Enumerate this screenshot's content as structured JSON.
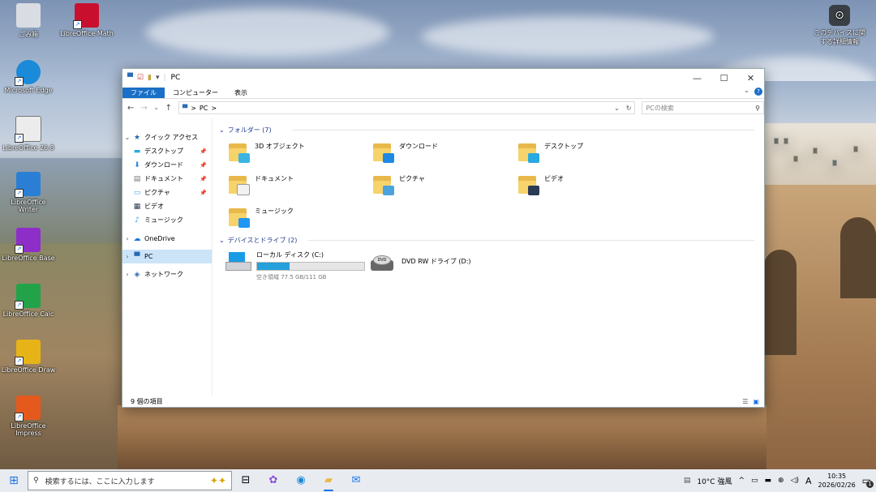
{
  "desktop": {
    "icons": [
      {
        "label": "ごみ箱",
        "icon": "recycle-bin-icon",
        "color": "#d9dde3"
      },
      {
        "label": "LibreOffice Math",
        "icon": "libreoffice-math-icon",
        "color": "#c8102e"
      },
      {
        "label": "Microsoft Edge",
        "icon": "edge-icon",
        "color": "#1b8ad8"
      },
      {
        "label": "LibreOffice 26.8",
        "icon": "libreoffice-icon",
        "color": "#ececec"
      },
      {
        "label": "LibreOffice Writer",
        "icon": "libreoffice-writer-icon",
        "color": "#2a7fd4"
      },
      {
        "label": "LibreOffice Base",
        "icon": "libreoffice-base-icon",
        "color": "#8e2ec9"
      },
      {
        "label": "LibreOffice Calc",
        "icon": "libreoffice-calc-icon",
        "color": "#22a34a"
      },
      {
        "label": "LibreOffice Draw",
        "icon": "libreoffice-draw-icon",
        "color": "#e7b417"
      },
      {
        "label": "LibreOffice Impress",
        "icon": "libreoffice-impress-icon",
        "color": "#e55a1c"
      },
      {
        "label": "このデバイスに関する詳細情報",
        "icon": "device-info-icon",
        "color": "#3a3f45"
      }
    ]
  },
  "explorer": {
    "title": "PC",
    "window_controls": {
      "minimize": "—",
      "maximize": "☐",
      "close": "✕"
    },
    "ribbon_tabs": [
      "ファイル",
      "コンピューター",
      "表示"
    ],
    "address": {
      "path_root": "PC",
      "separator": ">"
    },
    "search_placeholder": "PCの検索",
    "nav": {
      "quick_access": "クイック アクセス",
      "quick_items": [
        "デスクトップ",
        "ダウンロード",
        "ドキュメント",
        "ピクチャ",
        "ビデオ",
        "ミュージック"
      ],
      "onedrive": "OneDrive",
      "pc": "PC",
      "network": "ネットワーク"
    },
    "folders_group": "フォルダー (7)",
    "folders": [
      {
        "name": "3D オブジェクト",
        "badge": "#3bb4e5"
      },
      {
        "name": "ダウンロード",
        "badge": "#1e88e5"
      },
      {
        "name": "デスクトップ",
        "badge": "#29a9e1"
      },
      {
        "name": "ドキュメント",
        "badge": "#f2f2f2"
      },
      {
        "name": "ピクチャ",
        "badge": "#4aa3df"
      },
      {
        "name": "ビデオ",
        "badge": "#2b3a55"
      },
      {
        "name": "ミュージック",
        "badge": "#2196f3"
      }
    ],
    "drives_group": "デバイスとドライブ (2)",
    "drives": [
      {
        "name": "ローカル ディスク (C:)",
        "free_text": "空き領域 77.5 GB/111 GB",
        "used_fraction": 0.3
      },
      {
        "name": "DVD RW ドライブ (D:)"
      }
    ],
    "status": "9 個の項目"
  },
  "taskbar": {
    "search_placeholder": "検索するには、ここに入力します",
    "weather": "10°C  強風",
    "ime": "A",
    "time": "10:35",
    "date": "2026/02/26",
    "notification_count": "1"
  }
}
